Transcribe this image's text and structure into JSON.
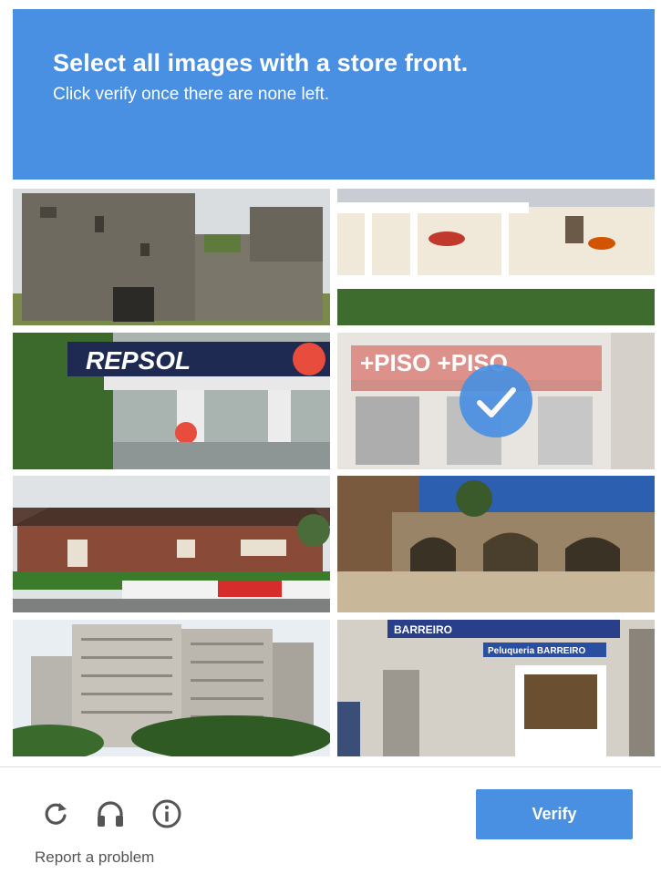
{
  "header": {
    "instruction_prefix": "Select all images with a ",
    "instruction_target": "store front.",
    "subtext": "Click verify once there are none left."
  },
  "tiles": [
    {
      "name": "tile-castle-ruins",
      "selected": false
    },
    {
      "name": "tile-house-porch",
      "selected": false
    },
    {
      "name": "tile-gas-station",
      "sign_text": "REPSOL",
      "selected": false
    },
    {
      "name": "tile-piso-store",
      "sign_text": "+PISO +PISO",
      "selected": true
    },
    {
      "name": "tile-brick-house",
      "selected": false
    },
    {
      "name": "tile-stone-arches",
      "selected": false
    },
    {
      "name": "tile-apartment-towers",
      "selected": false
    },
    {
      "name": "tile-shop-barreiro",
      "sign_text": "BARREIRO",
      "sign_text_2": "Peluqueria BARREIRO",
      "selected": false
    }
  ],
  "footer": {
    "reload_icon": "reload-icon",
    "audio_icon": "headphones-icon",
    "info_icon": "info-icon",
    "verify_label": "Verify",
    "report_label": "Report a problem"
  },
  "colors": {
    "accent": "#4a90e2",
    "header_text": "#ffffff",
    "icon_color": "#555555"
  }
}
